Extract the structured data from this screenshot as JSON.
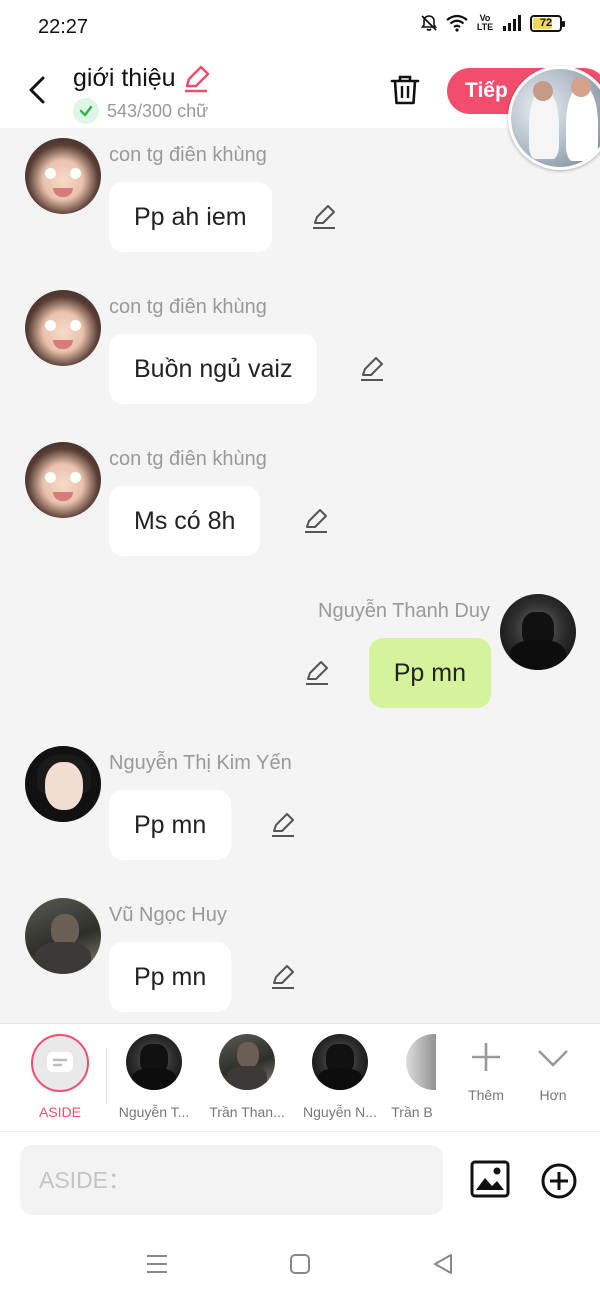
{
  "status_bar": {
    "time": "22:27",
    "network_label": "Vo LTE",
    "battery": "72",
    "battery_level": 0.72
  },
  "header": {
    "title": "giới thiệu",
    "word_count": "543/300 chữ",
    "next_label": "Tiếp",
    "accent_color": "#f24d6c"
  },
  "messages": [
    {
      "sender": "con tg điên khùng",
      "text": "Pp ah iem",
      "mine": false
    },
    {
      "sender": "con tg điên khùng",
      "text": "Buồn ngủ vaiz",
      "mine": false
    },
    {
      "sender": "con tg điên khùng",
      "text": "Ms có 8h",
      "mine": false
    },
    {
      "sender": "Nguyễn Thanh Duy",
      "text": "Pp mn",
      "mine": true
    },
    {
      "sender": "Nguyễn Thị Kim Yến",
      "text": "Pp mn",
      "mine": false
    },
    {
      "sender": "Vũ Ngọc Huy",
      "text": "Pp mn",
      "mine": false
    }
  ],
  "participants": {
    "aside_label": "ASIDE",
    "people": [
      "Nguyễn T...",
      "Trần Than...",
      "Nguyễn N...",
      "Trần B"
    ],
    "more_label": "Thêm",
    "expand_label": "Hơn"
  },
  "input": {
    "placeholder": "ASIDE："
  },
  "colors": {
    "my_bubble": "#d4f39a",
    "other_bubble": "#ffffff",
    "background": "#f4f4f4"
  },
  "icons": [
    "back-arrow-icon",
    "pencil-icon",
    "check-icon",
    "trash-icon",
    "edit-icon",
    "plus-icon",
    "chevron-down-icon",
    "image-icon",
    "add-circle-icon",
    "menu-icon",
    "home-square-icon",
    "back-triangle-icon"
  ]
}
